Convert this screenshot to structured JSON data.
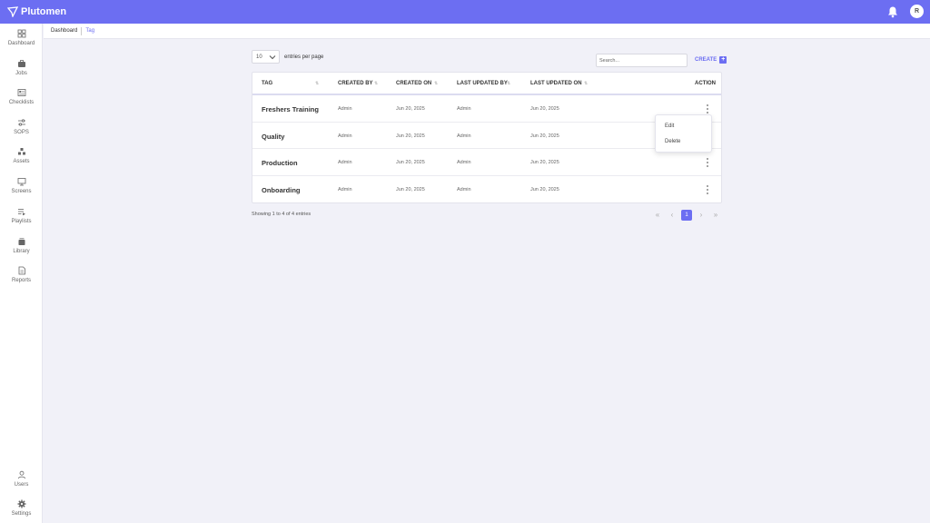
{
  "app": {
    "name": "Plutomen",
    "user_initial": "R",
    "accent": "#6c6ef2"
  },
  "sidebar": {
    "items": [
      {
        "label": "Dashboard",
        "icon": "grid-icon"
      },
      {
        "label": "Jobs",
        "icon": "briefcase-icon"
      },
      {
        "label": "Checklists",
        "icon": "checklist-icon"
      },
      {
        "label": "SOPS",
        "icon": "sliders-icon"
      },
      {
        "label": "Assets",
        "icon": "cubes-icon"
      },
      {
        "label": "Screens",
        "icon": "monitor-icon"
      },
      {
        "label": "Playlists",
        "icon": "playlist-icon"
      },
      {
        "label": "Library",
        "icon": "library-icon"
      },
      {
        "label": "Reports",
        "icon": "report-icon"
      }
    ],
    "bottom": [
      {
        "label": "Users",
        "icon": "user-icon"
      },
      {
        "label": "Settings",
        "icon": "gear-icon"
      }
    ]
  },
  "breadcrumb": {
    "root": "Dashboard",
    "current": "Tag"
  },
  "controls": {
    "entries_value": "10",
    "entries_label": "entries per page",
    "search_placeholder": "Search...",
    "create_label": "CREATE"
  },
  "table": {
    "headers": [
      "TAG",
      "CREATED BY",
      "CREATED ON",
      "LAST UPDATED BY",
      "LAST UPDATED ON",
      "ACTION"
    ],
    "rows": [
      {
        "tag": "Freshers Training",
        "created_by": "Admin",
        "created_on": "Jun 20, 2025",
        "updated_by": "Admin",
        "updated_on": "Jun 20, 2025"
      },
      {
        "tag": "Quality",
        "created_by": "Admin",
        "created_on": "Jun 20, 2025",
        "updated_by": "Admin",
        "updated_on": "Jun 20, 2025"
      },
      {
        "tag": "Production",
        "created_by": "Admin",
        "created_on": "Jun 20, 2025",
        "updated_by": "Admin",
        "updated_on": "Jun 20, 2025"
      },
      {
        "tag": "Onboarding",
        "created_by": "Admin",
        "created_on": "Jun 20, 2025",
        "updated_by": "Admin",
        "updated_on": "Jun 20, 2025"
      }
    ]
  },
  "action_menu": {
    "edit": "Edit",
    "delete": "Delete"
  },
  "footer": {
    "showing": "Showing 1 to 4 of 4 entries",
    "current_page": "1"
  }
}
